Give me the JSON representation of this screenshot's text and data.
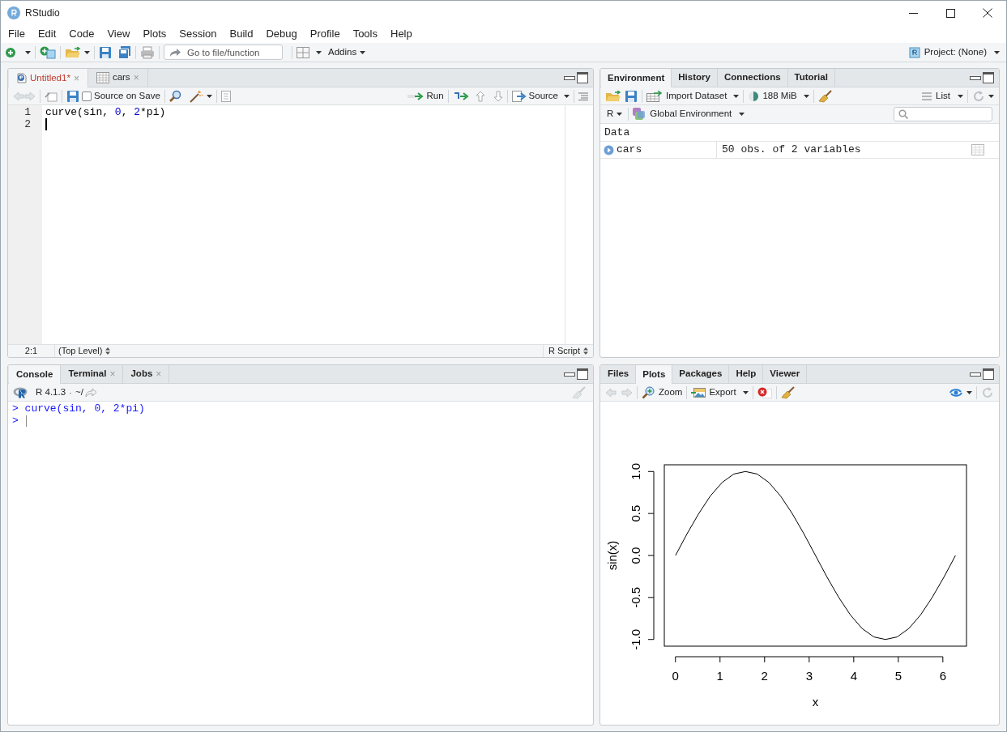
{
  "window": {
    "title": "RStudio"
  },
  "menu": [
    "File",
    "Edit",
    "Code",
    "View",
    "Plots",
    "Session",
    "Build",
    "Debug",
    "Profile",
    "Tools",
    "Help"
  ],
  "toolbar": {
    "goto_placeholder": "Go to file/function",
    "addins": "Addins",
    "project": "Project: (None)"
  },
  "source_pane": {
    "tabs": [
      {
        "label": "Untitled1*",
        "kind": "script",
        "modified": true,
        "close": "×",
        "selected": true
      },
      {
        "label": "cars",
        "kind": "data",
        "modified": false,
        "close": "×",
        "selected": false
      }
    ],
    "source_on_save": {
      "label": "Source on Save",
      "checked": false
    },
    "run": "Run",
    "source": "Source",
    "lines": [
      {
        "number": "1",
        "cursor": false,
        "tokens": [
          {
            "kind": "plain",
            "text": "curve(sin, "
          },
          {
            "kind": "number",
            "text": "0"
          },
          {
            "kind": "plain",
            "text": ", "
          },
          {
            "kind": "number",
            "text": "2"
          },
          {
            "kind": "plain",
            "text": "*pi)"
          }
        ]
      },
      {
        "number": "2",
        "cursor": true
      }
    ],
    "status": {
      "position": "2:1",
      "scope": "(Top Level)",
      "filetype": "R Script"
    }
  },
  "environment_pane": {
    "tabs": [
      {
        "label": "Environment",
        "selected": true
      },
      {
        "label": "History",
        "selected": false
      },
      {
        "label": "Connections",
        "selected": false
      },
      {
        "label": "Tutorial",
        "selected": false
      }
    ],
    "import": "Import Dataset",
    "memory": "188 MiB",
    "view": "List",
    "language": "R",
    "scope": "Global Environment",
    "section": "Data",
    "rows": [
      {
        "name": "cars",
        "value": "50 obs. of 2 variables"
      }
    ]
  },
  "console_pane": {
    "tabs": [
      {
        "label": "Console",
        "selected": true
      },
      {
        "label": "Terminal",
        "close": "×",
        "selected": false
      },
      {
        "label": "Jobs",
        "close": "×",
        "selected": false
      }
    ],
    "version": "R 4.1.3",
    "separator": "·",
    "path": "~/",
    "lines": [
      {
        "prompt": ">",
        "text": "curve(sin, 0, 2*pi)",
        "cursor": false
      },
      {
        "prompt": ">",
        "cursor": true
      }
    ]
  },
  "plots_pane": {
    "tabs": [
      {
        "label": "Files",
        "selected": false
      },
      {
        "label": "Plots",
        "selected": true
      },
      {
        "label": "Packages",
        "selected": false
      },
      {
        "label": "Help",
        "selected": false
      },
      {
        "label": "Viewer",
        "selected": false
      }
    ],
    "zoom": "Zoom",
    "export": "Export",
    "chart_data": {
      "type": "line",
      "xlabel": "x",
      "ylabel": "sin(x)",
      "x": [
        0,
        0.262,
        0.524,
        0.785,
        1.047,
        1.309,
        1.571,
        1.833,
        2.094,
        2.356,
        2.618,
        2.88,
        3.142,
        3.403,
        3.665,
        3.927,
        4.189,
        4.451,
        4.712,
        4.974,
        5.236,
        5.498,
        5.76,
        6.021,
        6.283
      ],
      "values": [
        0,
        0.26,
        0.5,
        0.71,
        0.87,
        0.97,
        1,
        0.97,
        0.87,
        0.71,
        0.5,
        0.26,
        0,
        -0.26,
        -0.5,
        -0.71,
        -0.87,
        -0.97,
        -1,
        -0.97,
        -0.87,
        -0.71,
        -0.5,
        -0.26,
        0
      ],
      "xlim": [
        -0.25,
        6.53
      ],
      "ylim": [
        -1.08,
        1.08
      ],
      "xticks": [
        0,
        1,
        2,
        3,
        4,
        5,
        6
      ],
      "yticks": [
        {
          "value": -1,
          "label": "-1.0"
        },
        {
          "value": -0.5,
          "label": "-0.5"
        },
        {
          "value": 0,
          "label": "0.0"
        },
        {
          "value": 0.5,
          "label": "0.5"
        },
        {
          "value": 1,
          "label": "1.0"
        }
      ]
    }
  }
}
